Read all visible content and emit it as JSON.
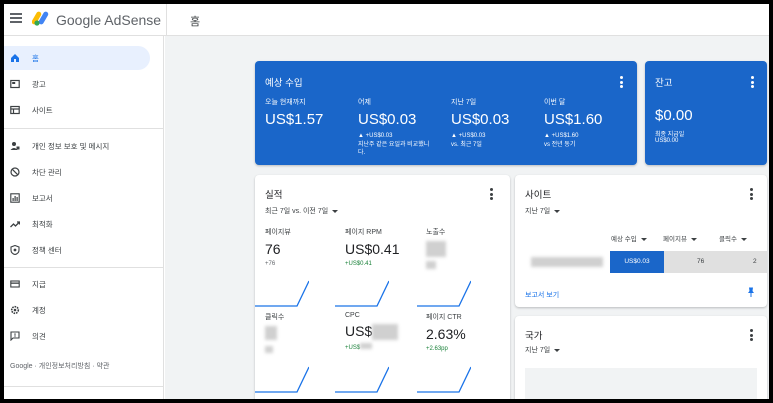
{
  "header": {
    "brand": "Google AdSense",
    "page_title": "홈"
  },
  "sidebar": {
    "items": [
      {
        "label": "홈",
        "icon": "home-icon",
        "active": true
      },
      {
        "label": "광고",
        "icon": "ads-icon"
      },
      {
        "label": "사이트",
        "icon": "sites-icon"
      },
      {
        "label": "개인 정보 보호 및 메시지",
        "icon": "privacy-icon"
      },
      {
        "label": "차단 관리",
        "icon": "block-icon"
      },
      {
        "label": "보고서",
        "icon": "reports-icon"
      },
      {
        "label": "최적화",
        "icon": "optimize-icon"
      },
      {
        "label": "정책 센터",
        "icon": "policy-icon"
      },
      {
        "label": "지급",
        "icon": "payments-icon"
      },
      {
        "label": "계정",
        "icon": "account-gear-icon"
      },
      {
        "label": "의견",
        "icon": "feedback-icon"
      }
    ],
    "footer": "Google · 개인정보처리방침 · 약관"
  },
  "estimated": {
    "title": "예상 수입",
    "columns": [
      {
        "label": "오늘 현재까지",
        "value": "US$1.57",
        "delta": "",
        "note": ""
      },
      {
        "label": "어제",
        "value": "US$0.03",
        "delta": "▲ +US$0.03",
        "note": "지난주 같은 요일과 비교했니다."
      },
      {
        "label": "지난 7일",
        "value": "US$0.03",
        "delta": "▲ +US$0.03",
        "note": "vs. 최근 7일"
      },
      {
        "label": "이번 달",
        "value": "US$1.60",
        "delta": "▲ +US$1.60",
        "note": "vs 전년 동기"
      }
    ]
  },
  "balance": {
    "title": "잔고",
    "value": "$0.00",
    "last_payment_label": "최종 지급일",
    "last_payment_value": "US$0.00"
  },
  "performance": {
    "title": "실적",
    "period": "최근 7일 vs. 이전 7일",
    "metrics": [
      {
        "label": "페이지뷰",
        "value": "76",
        "delta": "+76"
      },
      {
        "label": "페이지 RPM",
        "value": "US$0.41",
        "delta": "+US$0.41"
      },
      {
        "label": "노출수",
        "value": "",
        "delta": ""
      },
      {
        "label": "클릭수",
        "value": "",
        "delta": ""
      },
      {
        "label": "CPC",
        "value": "US$",
        "delta": "+US$"
      },
      {
        "label": "페이지 CTR",
        "value": "2.63%",
        "delta": "+2.63pp"
      }
    ]
  },
  "sites": {
    "title": "사이트",
    "period": "지난 7일",
    "columns": [
      "예상 수입",
      "페이지뷰",
      "클릭수"
    ],
    "row": {
      "earnings": "US$0.03",
      "pageviews": "76",
      "clicks": "2"
    },
    "report_link": "보고서 보기"
  },
  "countries": {
    "title": "국가",
    "period": "지난 7일"
  },
  "colors": {
    "accent": "#1a66c9",
    "link": "#1a73e8",
    "positive": "#188038"
  }
}
